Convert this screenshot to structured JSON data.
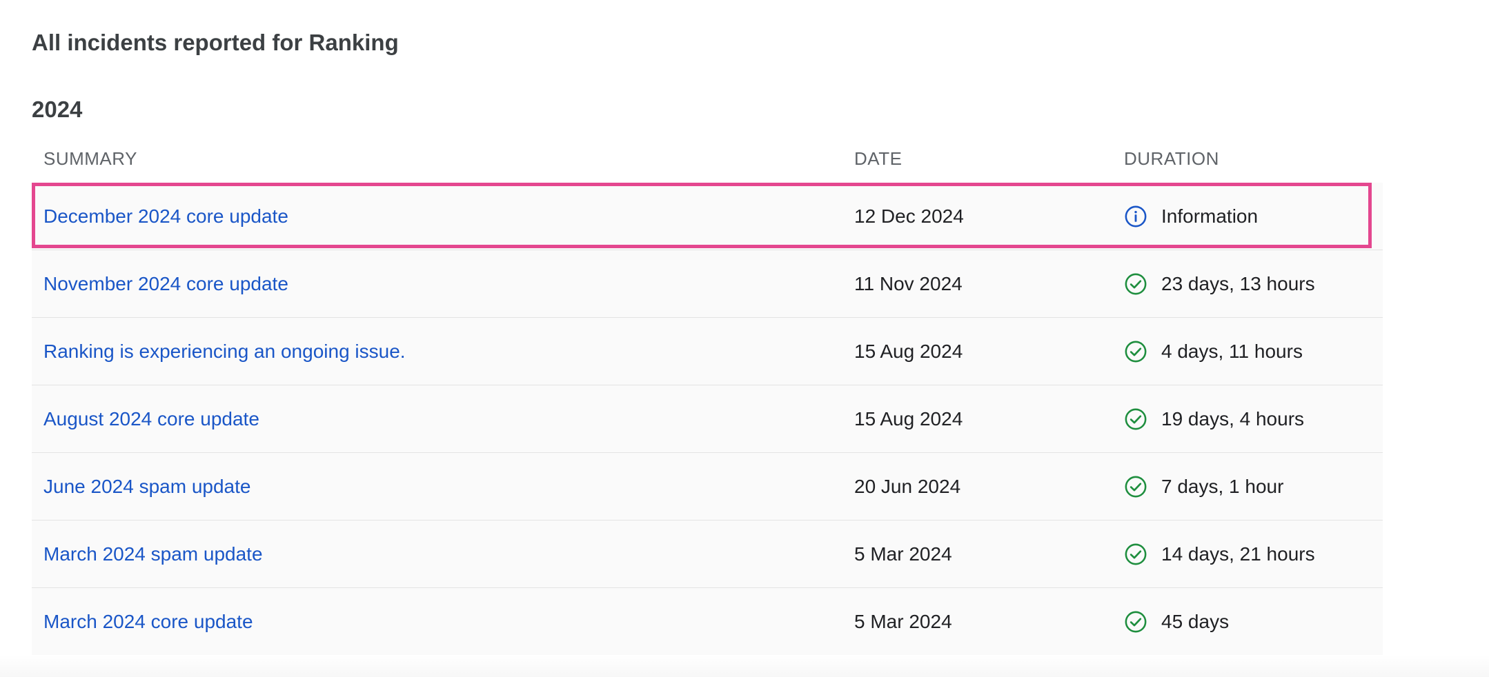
{
  "page": {
    "title": "All incidents reported for Ranking",
    "year": "2024"
  },
  "table": {
    "headers": {
      "summary": "SUMMARY",
      "date": "DATE",
      "duration": "DURATION"
    },
    "rows": [
      {
        "summary": "December 2024 core update",
        "date": "12 Dec 2024",
        "duration": "Information",
        "status": "info-icon"
      },
      {
        "summary": "November 2024 core update",
        "date": "11 Nov 2024",
        "duration": "23 days, 13 hours",
        "status": "check-circle-icon"
      },
      {
        "summary": "Ranking is experiencing an ongoing issue.",
        "date": "15 Aug 2024",
        "duration": "4 days, 11 hours",
        "status": "check-circle-icon"
      },
      {
        "summary": "August 2024 core update",
        "date": "15 Aug 2024",
        "duration": "19 days, 4 hours",
        "status": "check-circle-icon"
      },
      {
        "summary": "June 2024 spam update",
        "date": "20 Jun 2024",
        "duration": "7 days, 1 hour",
        "status": "check-circle-icon"
      },
      {
        "summary": "March 2024 spam update",
        "date": "5 Mar 2024",
        "duration": "14 days, 21 hours",
        "status": "check-circle-icon"
      },
      {
        "summary": "March 2024 core update",
        "date": "5 Mar 2024",
        "duration": "45 days",
        "status": "check-circle-icon"
      }
    ]
  },
  "colors": {
    "link": "#1a56c7",
    "info": "#1a56c7",
    "success": "#1e8e3e",
    "highlight": "#e4478f"
  }
}
